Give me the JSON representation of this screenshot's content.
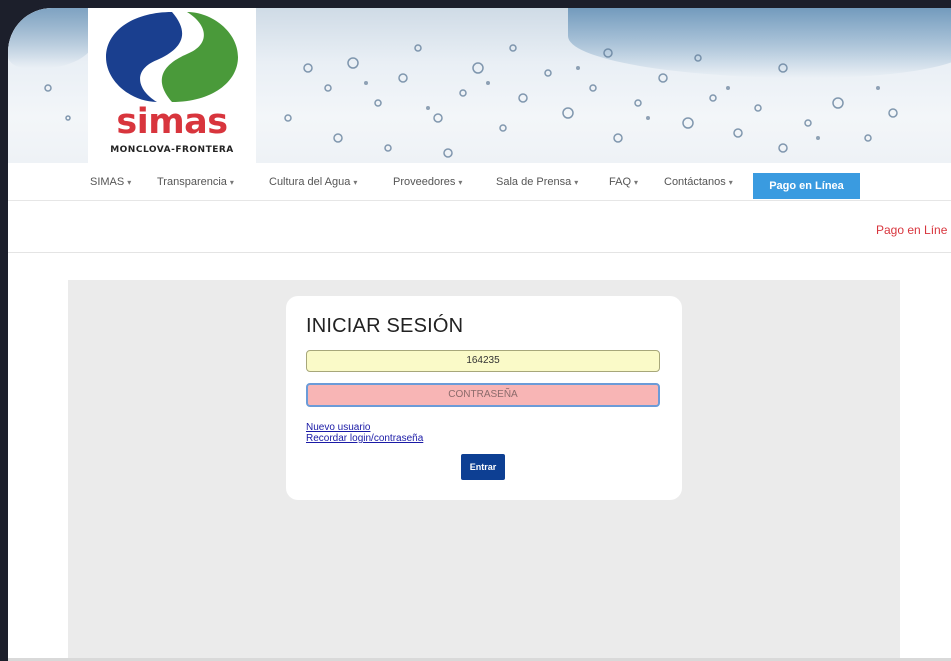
{
  "brand": {
    "name": "simas",
    "subtitle": "MONCLOVA-FRONTERA",
    "colors": {
      "blue": "#1a3f8f",
      "green": "#4a9a3a",
      "red": "#d8353d"
    }
  },
  "nav": {
    "items": [
      {
        "label": "SIMAS",
        "caret": "▾"
      },
      {
        "label": "Transparencia",
        "caret": "▾"
      },
      {
        "label": "Cultura del Agua",
        "caret": "▾"
      },
      {
        "label": "Proveedores",
        "caret": "▾"
      },
      {
        "label": "Sala de Prensa",
        "caret": "▾"
      },
      {
        "label": "FAQ",
        "caret": "▾"
      },
      {
        "label": "Contáctanos",
        "caret": "▾"
      }
    ],
    "cta_label": "Pago en Línea"
  },
  "subbar": {
    "link_label": "Pago en Líne"
  },
  "login": {
    "title": "INICIAR SESIÓN",
    "user_value": "164235",
    "password_placeholder": "CONTRASEÑA",
    "new_user_link": "Nuevo usuario",
    "recover_link": "Recordar login/contraseña",
    "submit_label": "Entrar"
  }
}
